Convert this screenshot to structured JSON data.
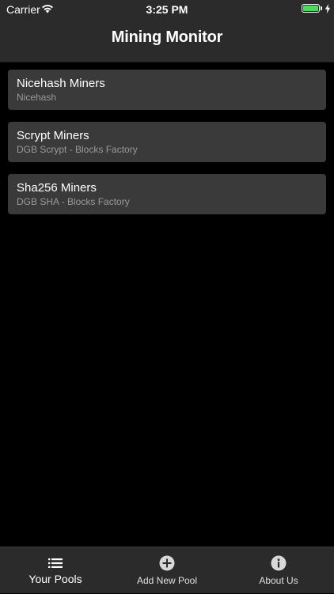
{
  "status_bar": {
    "carrier": "Carrier",
    "time": "3:25 PM",
    "battery_level": 1.0,
    "battery_color": "#4cd964",
    "icons": [
      "wifi-icon",
      "battery-icon",
      "charging-bolt-icon"
    ]
  },
  "nav": {
    "title": "Mining Monitor"
  },
  "pools": [
    {
      "name": "Nicehash Miners",
      "subtitle": "Nicehash"
    },
    {
      "name": "Scrypt Miners",
      "subtitle": "DGB Scrypt - Blocks Factory"
    },
    {
      "name": "Sha256 Miners",
      "subtitle": "DGB SHA - Blocks Factory"
    }
  ],
  "tabs": [
    {
      "label": "Your Pools",
      "icon": "list-icon",
      "active": true
    },
    {
      "label": "Add New Pool",
      "icon": "plus-circle-icon",
      "active": false
    },
    {
      "label": "About Us",
      "icon": "info-circle-icon",
      "active": false
    }
  ],
  "colors": {
    "background": "#000000",
    "bar_background": "#2b2b2b",
    "cell_background": "#3a3a3a",
    "subtitle_text": "#9a9a9a"
  }
}
